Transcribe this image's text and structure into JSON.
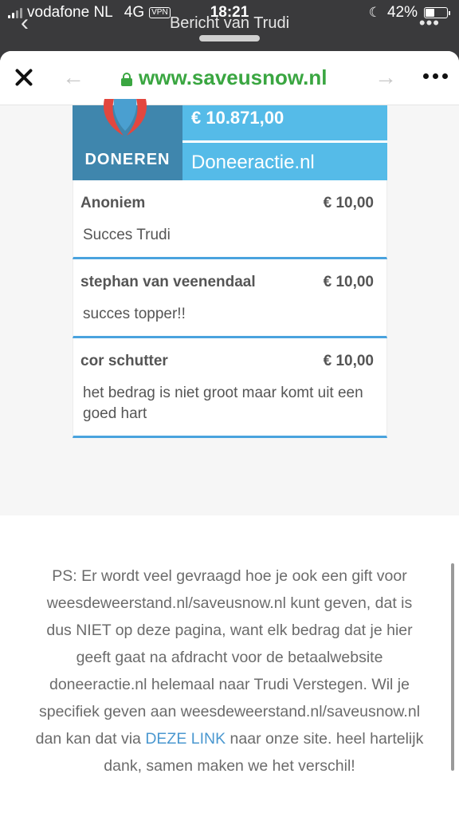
{
  "status_bar": {
    "carrier": "vodafone NL",
    "network": "4G",
    "vpn": "VPN",
    "time": "18:21",
    "battery_percent": "42%",
    "battery_level": 0.42
  },
  "behind_sheet": {
    "title": "Bericht van Trudi"
  },
  "browser": {
    "url": "www.saveusnow.nl",
    "icons": {
      "close": "close-icon",
      "back": "arrow-left-icon",
      "forward": "arrow-right-icon",
      "lock": "lock-icon",
      "more": "more-icon"
    }
  },
  "donation_widget": {
    "button_label": "DONEREN",
    "total_amount": "€ 10.871,00",
    "site_label": "Doneeractie.nl",
    "donations": [
      {
        "name": "Anoniem",
        "amount": "€ 10,00",
        "message": "Succes Trudi"
      },
      {
        "name": "stephan van veenendaal",
        "amount": "€ 10,00",
        "message": "succes topper!!"
      },
      {
        "name": "cor schutter",
        "amount": "€ 10,00",
        "message": "het bedrag is niet groot maar komt uit een goed hart"
      }
    ]
  },
  "ps_text": {
    "before_link": "PS: Er wordt veel gevraagd hoe je ook een gift voor weesdeweerstand.nl/saveusnow.nl kunt geven, dat is dus NIET op deze pagina, want elk bedrag dat je hier geeft gaat na afdracht voor de betaalwebsite doneeractie.nl helemaal naar Trudi Verstegen. Wil je specifiek geven aan weesdeweerstand.nl/saveusnow.nl dan kan dat via",
    "link": "DEZE LINK",
    "after_link": "naar onze site. heel hartelijk dank, samen maken we het verschil!"
  },
  "colors": {
    "url_green": "#3aa641",
    "widget_blue": "#55bbe8",
    "logo_blue": "#3f86ad",
    "row_border": "#4aa3de",
    "link_blue": "#4b98d0"
  }
}
